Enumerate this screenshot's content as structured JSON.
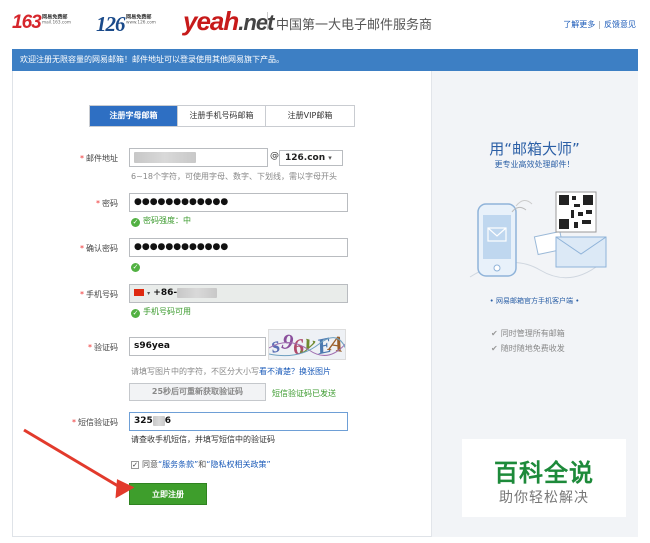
{
  "header": {
    "logo_163": "163",
    "logo_163_sub1": "网易免费邮",
    "logo_163_sub2": "mail.163.com",
    "logo_126": "126",
    "logo_126_sub1": "网易免费邮",
    "logo_126_sub2": "www.126.com",
    "logo_yeah": "yeah",
    "logo_yeah_net": ".net",
    "slogan": "中国第一大电子邮件服务商",
    "link_more": "了解更多",
    "link_separator": "|",
    "link_feedback": "反馈意见"
  },
  "banner": {
    "text": "欢迎注册无限容量的网易邮箱！邮件地址可以登录使用其他网易旗下产品。"
  },
  "tabs": [
    {
      "label": "注册字母邮箱",
      "active": true
    },
    {
      "label": "注册手机号码邮箱",
      "active": false
    },
    {
      "label": "注册VIP邮箱",
      "active": false
    }
  ],
  "form": {
    "required_mark": "*",
    "email": {
      "label": "邮件地址",
      "at": "@",
      "domain": "126.con",
      "domain_arrow": "▾",
      "hint": "6~18个字符，可使用字母、数字、下划线，需以字母开头"
    },
    "password": {
      "label": "密码",
      "value": "●●●●●●●●●●●●",
      "strength": "密码强度：中"
    },
    "confirm_password": {
      "label": "确认密码",
      "value": "●●●●●●●●●●●●"
    },
    "phone": {
      "label": "手机号码",
      "prefix": "+86-",
      "dropdown_arrow": "▾",
      "status": "手机号码可用"
    },
    "captcha": {
      "label": "验证码",
      "value": "s96yea",
      "hint": "请填写图片中的字符，不区分大小写",
      "refresh_text": "看不清楚？换张图片",
      "image_chars": [
        "s",
        "9",
        "6",
        "y",
        "E",
        "A"
      ]
    },
    "resend": {
      "button_label": "25秒后可重新获取验证码",
      "sent_text": "短信验证码已发送"
    },
    "sms_code": {
      "label": "短信验证码",
      "value_start": "325",
      "value_end": "6",
      "hint": "请查收手机短信，并填写短信中的验证码"
    },
    "agreement": {
      "prefix": "同意",
      "terms": "“服务条款”",
      "and": "和",
      "privacy": "“隐私权相关政策”",
      "checked": true
    },
    "submit_label": "立即注册"
  },
  "ad": {
    "title": "用“邮箱大师”",
    "subtitle": "更专业高效处理邮件！",
    "caption": "• 网易邮箱官方手机客户端 •",
    "features": [
      "同时管理所有邮箱",
      "随时随地免费收发"
    ],
    "feature_mark": "✔"
  },
  "watermark": {
    "big": "百科全说",
    "small": "助你轻松解决"
  },
  "colors": {
    "brand_blue": "#3d7fc4",
    "tab_active": "#2e6fc3",
    "submit_green": "#3e9e2c",
    "ok_green": "#52b142",
    "required_red": "#e33333",
    "arrow_red": "#e23a2c"
  }
}
